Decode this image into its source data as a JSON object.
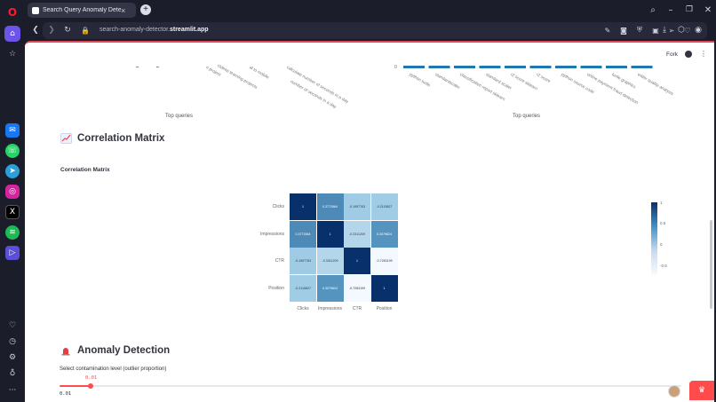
{
  "browser": {
    "tab_title": "Search Query Anomaly Dete",
    "url_prefix": "search-anomaly-detector.",
    "url_domain": "streamlit.app",
    "tab_close": "×",
    "new_tab": "+"
  },
  "app": {
    "fork_label": "Fork",
    "menu_glyph": "⋮"
  },
  "top_charts": {
    "left_xtitle": "Top queries",
    "left_labels": [
      "n project",
      "ctdeep learning projects",
      "al to mobile",
      "calculate number of seconds in a day",
      "number of seconds in a day"
    ],
    "right_xtitle": "Top queries",
    "right_zero": "0",
    "right_labels": [
      "python turtle",
      "standardscaler",
      "classification report sklearn",
      "standard scaler",
      "r2 score sklearn",
      "r2 score",
      "python source code",
      "online payment fraud detection",
      "turtle graphics",
      "water quality analysis"
    ]
  },
  "correlation": {
    "header": "Correlation Matrix",
    "subtitle": "Correlation Matrix",
    "row_labels": [
      "Clicks",
      "Impressions",
      "CTR",
      "Position"
    ],
    "col_labels": [
      "Clicks",
      "Impressions",
      "CTR",
      "Position"
    ],
    "cells": [
      [
        "1",
        "0.3772664",
        "-0.1997763",
        "-0.2115827"
      ],
      [
        "0.3772664",
        "1",
        "-0.3311209",
        "0.3079624"
      ],
      [
        "-0.1997763",
        "-0.3311209",
        "1",
        "-0.7283199"
      ],
      [
        "-0.2115827",
        "0.3079624",
        "-0.7283199",
        "1"
      ]
    ],
    "values": [
      [
        1,
        0.377,
        -0.2,
        -0.212
      ],
      [
        0.377,
        1,
        -0.331,
        0.308
      ],
      [
        -0.2,
        -0.331,
        1,
        -0.728
      ],
      [
        -0.212,
        0.308,
        -0.728,
        1
      ]
    ],
    "colorbar_ticks": [
      "1",
      "0.5",
      "0",
      "-0.5"
    ]
  },
  "anomaly": {
    "header": "Anomaly Detection",
    "slider_label": "Select contamination level (outlier proportion)",
    "slider_value": 0.01,
    "slider_value_text": "0.01",
    "slider_min_text": "0.01",
    "slider_fraction": 0.05
  },
  "colors": {
    "accent": "#ff4b4b",
    "browser_bg": "#1c1d2b",
    "heatmap_high": "#08306b",
    "heatmap_low": "#f7fbff"
  }
}
